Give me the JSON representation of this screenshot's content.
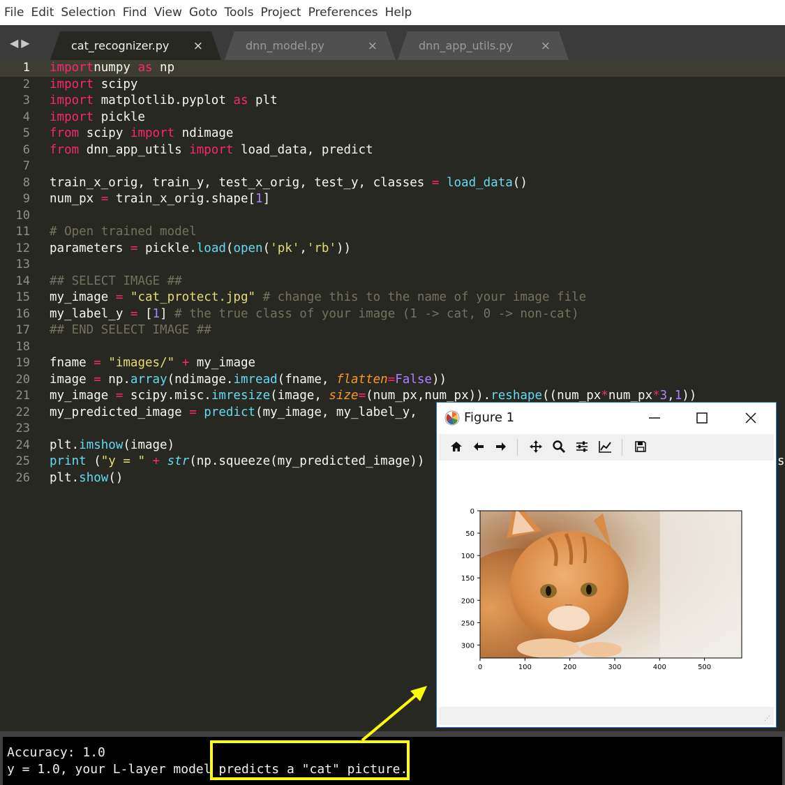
{
  "menu": [
    "File",
    "Edit",
    "Selection",
    "Find",
    "View",
    "Goto",
    "Tools",
    "Project",
    "Preferences",
    "Help"
  ],
  "tabs": [
    {
      "label": "cat_recognizer.py",
      "active": true
    },
    {
      "label": "dnn_model.py",
      "active": false
    },
    {
      "label": "dnn_app_utils.py",
      "active": false
    }
  ],
  "tab_close_glyph": "×",
  "editor": {
    "current_line": 1,
    "lines": [
      {
        "n": "1",
        "tokens": [
          [
            "kw",
            "import"
          ],
          [
            "",
            "numpy "
          ],
          [
            "kw",
            "as"
          ],
          [
            "",
            " np"
          ]
        ]
      },
      {
        "n": "2",
        "tokens": [
          [
            "kw",
            "import"
          ],
          [
            "",
            " scipy"
          ]
        ]
      },
      {
        "n": "3",
        "tokens": [
          [
            "kw",
            "import"
          ],
          [
            "",
            " matplotlib.pyplot "
          ],
          [
            "kw",
            "as"
          ],
          [
            "",
            " plt"
          ]
        ]
      },
      {
        "n": "4",
        "tokens": [
          [
            "kw",
            "import"
          ],
          [
            "",
            " pickle"
          ]
        ]
      },
      {
        "n": "5",
        "tokens": [
          [
            "kw",
            "from"
          ],
          [
            "",
            " scipy "
          ],
          [
            "kw",
            "import"
          ],
          [
            "",
            " ndimage"
          ]
        ]
      },
      {
        "n": "6",
        "tokens": [
          [
            "kw",
            "from"
          ],
          [
            "",
            " dnn_app_utils "
          ],
          [
            "kw",
            "import"
          ],
          [
            "",
            " load_data, predict"
          ]
        ]
      },
      {
        "n": "7",
        "tokens": []
      },
      {
        "n": "8",
        "tokens": [
          [
            "",
            "train_x_orig, train_y, test_x_orig, test_y, classes "
          ],
          [
            "kw",
            "="
          ],
          [
            " fn",
            " load_data"
          ],
          [
            "",
            "()"
          ]
        ]
      },
      {
        "n": "9",
        "tokens": [
          [
            "",
            "num_px "
          ],
          [
            "kw",
            "="
          ],
          [
            "",
            " train_x_orig.shape["
          ],
          [
            "nu",
            "1"
          ],
          [
            "",
            "]"
          ]
        ]
      },
      {
        "n": "10",
        "tokens": []
      },
      {
        "n": "11",
        "tokens": [
          [
            "cm",
            "# Open trained model"
          ]
        ]
      },
      {
        "n": "12",
        "tokens": [
          [
            "",
            "parameters "
          ],
          [
            "kw",
            "="
          ],
          [
            "",
            " pickle."
          ],
          [
            "fn",
            "load"
          ],
          [
            "",
            "("
          ],
          [
            "fn",
            "open"
          ],
          [
            "",
            "("
          ],
          [
            "st",
            "'pk'"
          ],
          [
            "",
            ","
          ],
          [
            "st",
            "'rb'"
          ],
          [
            "",
            "))"
          ]
        ]
      },
      {
        "n": "13",
        "tokens": []
      },
      {
        "n": "14",
        "tokens": [
          [
            "cm",
            "## SELECT IMAGE ##"
          ]
        ]
      },
      {
        "n": "15",
        "tokens": [
          [
            "",
            "my_image "
          ],
          [
            "kw",
            "="
          ],
          [
            "",
            " "
          ],
          [
            "st",
            "\"cat_protect.jpg\""
          ],
          [
            "",
            " "
          ],
          [
            "cm",
            "# change this to the name of your image file"
          ]
        ]
      },
      {
        "n": "16",
        "tokens": [
          [
            "",
            "my_label_y "
          ],
          [
            "kw",
            "="
          ],
          [
            "",
            " ["
          ],
          [
            "nu",
            "1"
          ],
          [
            "",
            "] "
          ],
          [
            "cm",
            "# the true class of your image (1 -> cat, 0 -> non-cat)"
          ]
        ]
      },
      {
        "n": "17",
        "tokens": [
          [
            "cm",
            "## END SELECT IMAGE ##"
          ]
        ]
      },
      {
        "n": "18",
        "tokens": []
      },
      {
        "n": "19",
        "tokens": [
          [
            "",
            "fname "
          ],
          [
            "kw",
            "="
          ],
          [
            "",
            " "
          ],
          [
            "st",
            "\"images/\""
          ],
          [
            "",
            " "
          ],
          [
            "kw",
            "+"
          ],
          [
            "",
            " my_image"
          ]
        ]
      },
      {
        "n": "20",
        "tokens": [
          [
            "",
            "image "
          ],
          [
            "kw",
            "="
          ],
          [
            "",
            " np."
          ],
          [
            "fn",
            "array"
          ],
          [
            "",
            "(ndimage."
          ],
          [
            "fn",
            "imread"
          ],
          [
            "",
            "(fname, "
          ],
          [
            "pa",
            "flatten"
          ],
          [
            "kw",
            "="
          ],
          [
            "nu",
            "False"
          ],
          [
            "",
            "))"
          ]
        ]
      },
      {
        "n": "21",
        "tokens": [
          [
            "",
            "my_image "
          ],
          [
            "kw",
            "="
          ],
          [
            "",
            " scipy.misc."
          ],
          [
            "fn",
            "imresize"
          ],
          [
            "",
            "(image, "
          ],
          [
            "pa",
            "size"
          ],
          [
            "kw",
            "="
          ],
          [
            "",
            "(num_px,num_px))."
          ],
          [
            "fn",
            "reshape"
          ],
          [
            "",
            "((num_px"
          ],
          [
            "kw",
            "*"
          ],
          [
            "",
            "num_px"
          ],
          [
            "kw",
            "*"
          ],
          [
            "nu",
            "3"
          ],
          [
            "",
            ","
          ],
          [
            "nu",
            "1"
          ],
          [
            "",
            "))"
          ]
        ]
      },
      {
        "n": "22",
        "tokens": [
          [
            "",
            "my_predicted_image "
          ],
          [
            "kw",
            "="
          ],
          [
            " fn",
            " predict"
          ],
          [
            "",
            "(my_image, my_label_y, "
          ]
        ]
      },
      {
        "n": "23",
        "tokens": []
      },
      {
        "n": "24",
        "tokens": [
          [
            "",
            "plt."
          ],
          [
            "fn",
            "imshow"
          ],
          [
            "",
            "(image)"
          ]
        ]
      },
      {
        "n": "25",
        "tokens": [
          [
            "fn",
            "print"
          ],
          [
            "",
            " ("
          ],
          [
            "st",
            "\"y = \""
          ],
          [
            "",
            " "
          ],
          [
            "kw",
            "+"
          ],
          [
            "",
            " "
          ],
          [
            "it",
            "str"
          ],
          [
            "",
            "(np.squeeze(my_predicted_image))"
          ]
        ]
      },
      {
        "n": "26",
        "tokens": [
          [
            "",
            "plt."
          ],
          [
            "fn",
            "show"
          ],
          [
            "",
            "()"
          ]
        ]
      }
    ],
    "overflow_char": "s"
  },
  "console": {
    "lines": [
      "Accuracy: 1.0",
      "y = 1.0, your L-layer model predicts a \"cat\" picture."
    ]
  },
  "figure": {
    "title": "Figure 1",
    "window_buttons": [
      "minimize",
      "maximize",
      "close"
    ],
    "toolbar_icons": [
      "home-icon",
      "back-arrow-icon",
      "forward-arrow-icon",
      "pan-icon",
      "zoom-icon",
      "configure-subplots-icon",
      "edit-axes-icon",
      "save-icon"
    ],
    "plot": {
      "y_ticks": [
        "0",
        "50",
        "100",
        "150",
        "200",
        "250",
        "300"
      ],
      "x_ticks": [
        "0",
        "100",
        "200",
        "300",
        "400",
        "500"
      ],
      "image_width": 583,
      "image_height": 329,
      "subject": "orange tabby cat lying down"
    }
  },
  "colors": {
    "annotation": "#ffff00",
    "figure_border": "#1e7ad6",
    "editor_bg": "#272822"
  }
}
